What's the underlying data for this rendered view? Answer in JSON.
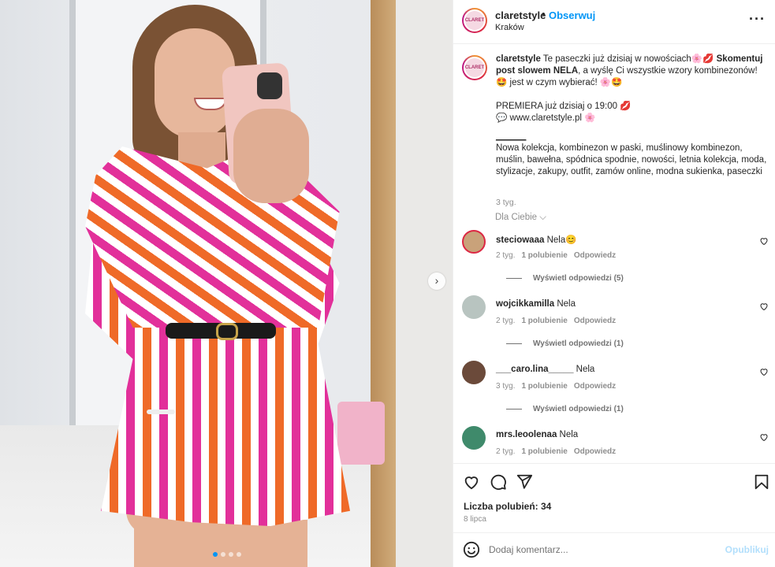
{
  "post": {
    "username": "claretstyle",
    "separator": "•",
    "follow_label": "Obserwuj",
    "location": "Kraków",
    "more_label": "···",
    "avatar_text": "CLARET"
  },
  "caption": {
    "username": "claretstyle",
    "part1": " Te paseczki już dzisiaj w nowościach🌸💋 ",
    "bold": "Skomentuj post slowem NELA",
    "part2": ", a wyślę Ci wszystkie wzory kombinezonów! 🤩 jest w czym wybierać! 🌸🤩",
    "line_premiere": "PREMIERA już dzisiaj o 19:00 💋",
    "line_site": "💬 www.claretstyle.pl 🌸",
    "line_divider": "______",
    "line_tags": "Nowa kolekcja, kombinezon w paski, muślinowy kombinezon, muślin, bawełna, spódnica spodnie, nowości, letnia kolekcja, moda, stylizacje, zakupy, outfit, zamów online, modna sukienka, paseczki",
    "time": "3 tyg."
  },
  "for_you_label": "Dla Ciebie ⌵",
  "comments": [
    {
      "user": "steciowaaa",
      "text": "Nela😊",
      "time": "2 tyg.",
      "likes": "1 polubienie",
      "reply": "Odpowiedz",
      "view_replies": "Wyświetl odpowiedzi (5)",
      "avatar_color": "#c9a27a"
    },
    {
      "user": "wojcikkamilla",
      "text": "Nela",
      "time": "2 tyg.",
      "likes": "1 polubienie",
      "reply": "Odpowiedz",
      "view_replies": "Wyświetl odpowiedzi (1)",
      "avatar_color": "#b8c4c0"
    },
    {
      "user": "___caro.lina_____",
      "text": "Nela",
      "time": "3 tyg.",
      "likes": "1 polubienie",
      "reply": "Odpowiedz",
      "view_replies": "Wyświetl odpowiedzi (1)",
      "avatar_color": "#6b4a3a"
    },
    {
      "user": "mrs.leoolenaa",
      "text": "Nela",
      "time": "2 tyg.",
      "likes": "1 polubienie",
      "reply": "Odpowiedz",
      "view_replies": "",
      "avatar_color": "#3f8a6b"
    }
  ],
  "stats": {
    "likes_label": "Liczba polubień: 34",
    "date": "8 lipca"
  },
  "add_comment": {
    "placeholder": "Dodaj komentarz...",
    "publish_label": "Opublikuj"
  },
  "carousel": {
    "total": 4,
    "active_index": 0,
    "next_icon": "›"
  },
  "colors": {
    "accent": "#0095f6",
    "muted": "#8e8e8e",
    "publish_disabled": "#b2dffc"
  },
  "icons": [
    "more-icon",
    "heart-icon",
    "comment-icon",
    "share-icon",
    "bookmark-icon",
    "emoji-icon",
    "chevron-right-icon"
  ]
}
